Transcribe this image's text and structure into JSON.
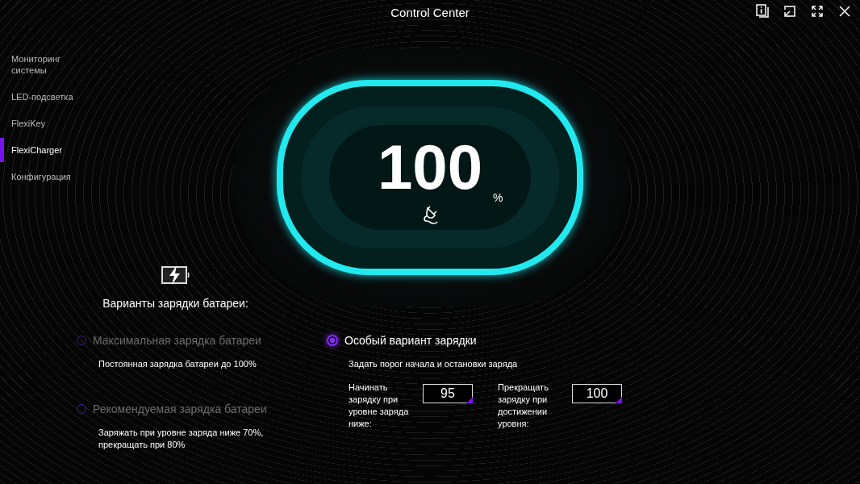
{
  "window": {
    "title": "Control Center"
  },
  "sidebar": {
    "items": [
      {
        "label": "Мониторинг системы",
        "selected": false
      },
      {
        "label": "LED-подсветка",
        "selected": false
      },
      {
        "label": "FlexiKey",
        "selected": false
      },
      {
        "label": "FlexiCharger",
        "selected": true
      },
      {
        "label": "Конфигурация",
        "selected": false
      }
    ]
  },
  "battery": {
    "reading": "100",
    "unit": "%",
    "plugged_in": true
  },
  "charging_options": {
    "heading": "Варианты зарядки батареи:",
    "options": [
      {
        "kind": "preset",
        "label": "Максимальная зарядка батареи",
        "selected": false,
        "description": "Постоянная зарядка батареи до 100%"
      },
      {
        "kind": "preset",
        "label": "Рекомендуемая зарядка батареи",
        "selected": false,
        "description": "Заряжать при уровне заряда ниже 70%, прекращать при 80%"
      },
      {
        "kind": "custom",
        "label": "Особый вариант зарядки",
        "selected": true,
        "description": "Задать порог начала и остановки заряда",
        "thresholds": [
          {
            "label": "Начинать зарядку при уровне заряда ниже:",
            "value": "95"
          },
          {
            "label": "Прекращать зарядку при достижении уровня:",
            "value": "100"
          }
        ]
      }
    ]
  }
}
